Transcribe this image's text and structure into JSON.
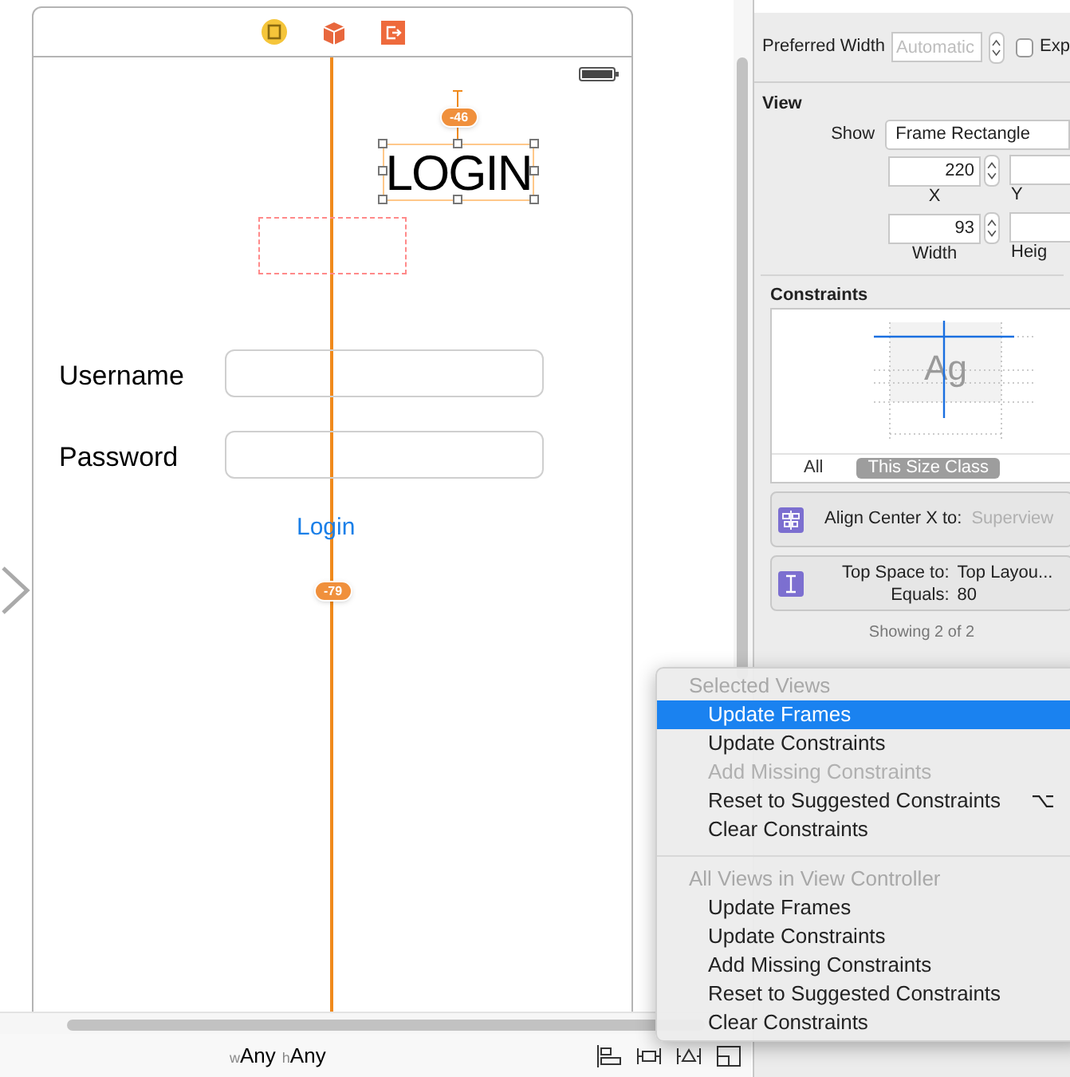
{
  "canvas": {
    "title_label": "LOGIN",
    "top_badge": "-46",
    "bottom_badge": "-79",
    "fields": [
      {
        "label": "Username"
      },
      {
        "label": "Password"
      }
    ],
    "button": "Login"
  },
  "size_class": {
    "w_prefix": "w",
    "w_value": "Any",
    "h_prefix": "h",
    "h_value": "Any"
  },
  "inspector": {
    "preferred_width": {
      "label": "Preferred Width",
      "placeholder": "Automatic"
    },
    "explicit": {
      "label": "Exp",
      "checked": false
    },
    "view": {
      "heading": "View",
      "show_label": "Show",
      "show_value": "Frame Rectangle",
      "x": {
        "value": "220",
        "caption": "X"
      },
      "y": {
        "caption": "Y"
      },
      "width": {
        "value": "93",
        "caption": "Width"
      },
      "height": {
        "caption": "Heig"
      }
    },
    "constraints": {
      "heading": "Constraints",
      "preview_text": "Ag",
      "tabs": [
        {
          "label": "All",
          "selected": false
        },
        {
          "label": "This Size Class",
          "selected": true
        }
      ],
      "items": [
        {
          "kind": "align",
          "label": "Align Center X to:",
          "value": "Superview"
        },
        {
          "kind": "space",
          "label": "Top Space to:",
          "value": "Top Layou...",
          "equals_label": "Equals:",
          "equals_value": "80"
        }
      ],
      "footer": "Showing 2 of 2"
    }
  },
  "menu": {
    "sections": [
      {
        "header": "Selected Views",
        "items": [
          {
            "label": "Update Frames",
            "selected": true,
            "disabled": false
          },
          {
            "label": "Update Constraints",
            "selected": false,
            "disabled": false
          },
          {
            "label": "Add Missing Constraints",
            "selected": false,
            "disabled": true
          },
          {
            "label": "Reset to Suggested Constraints",
            "selected": false,
            "disabled": false,
            "shortcut": "⌥"
          },
          {
            "label": "Clear Constraints",
            "selected": false,
            "disabled": false
          }
        ]
      },
      {
        "header": "All Views in View Controller",
        "items": [
          {
            "label": "Update Frames",
            "selected": false,
            "disabled": false
          },
          {
            "label": "Update Constraints",
            "selected": false,
            "disabled": false
          },
          {
            "label": "Add Missing Constraints",
            "selected": false,
            "disabled": false
          },
          {
            "label": "Reset to Suggested Constraints",
            "selected": false,
            "disabled": false
          },
          {
            "label": "Clear Constraints",
            "selected": false,
            "disabled": false
          }
        ]
      }
    ]
  }
}
